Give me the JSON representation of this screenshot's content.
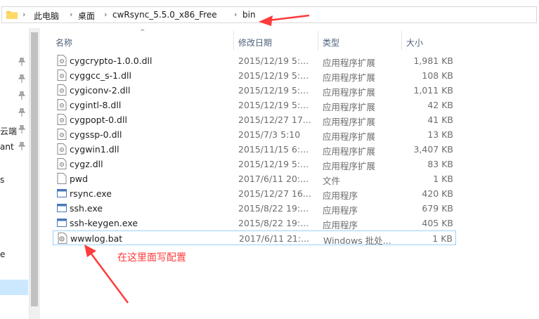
{
  "breadcrumb": [
    "此电脑",
    "桌面",
    "cwRsync_5.5.0_x86_Free",
    "bin"
  ],
  "nav_items": [
    "云端",
    "ant",
    "s",
    "e"
  ],
  "columns": {
    "name": "名称",
    "date": "修改日期",
    "type": "类型",
    "size": "大小"
  },
  "files": [
    {
      "name": "cygcrypto-1.0.0.dll",
      "date": "2015/12/19 5:...",
      "type": "应用程序扩展",
      "size": "1,981 KB",
      "icon": "dll-icon"
    },
    {
      "name": "cyggcc_s-1.dll",
      "date": "2015/12/19 5:...",
      "type": "应用程序扩展",
      "size": "108 KB",
      "icon": "dll-icon"
    },
    {
      "name": "cygiconv-2.dll",
      "date": "2015/12/19 5:...",
      "type": "应用程序扩展",
      "size": "1,011 KB",
      "icon": "dll-icon"
    },
    {
      "name": "cygintl-8.dll",
      "date": "2015/12/19 5:...",
      "type": "应用程序扩展",
      "size": "42 KB",
      "icon": "dll-icon"
    },
    {
      "name": "cygpopt-0.dll",
      "date": "2015/12/27 17...",
      "type": "应用程序扩展",
      "size": "41 KB",
      "icon": "dll-icon"
    },
    {
      "name": "cygssp-0.dll",
      "date": "2015/7/3 5:10",
      "type": "应用程序扩展",
      "size": "13 KB",
      "icon": "dll-icon"
    },
    {
      "name": "cygwin1.dll",
      "date": "2015/11/15 6:...",
      "type": "应用程序扩展",
      "size": "3,407 KB",
      "icon": "dll-icon"
    },
    {
      "name": "cygz.dll",
      "date": "2015/12/19 5:...",
      "type": "应用程序扩展",
      "size": "83 KB",
      "icon": "dll-icon"
    },
    {
      "name": "pwd",
      "date": "2017/6/11 20:...",
      "type": "文件",
      "size": "1 KB",
      "icon": "file-icon"
    },
    {
      "name": "rsync.exe",
      "date": "2015/12/27 16...",
      "type": "应用程序",
      "size": "420 KB",
      "icon": "exe-icon"
    },
    {
      "name": "ssh.exe",
      "date": "2015/8/22 19:...",
      "type": "应用程序",
      "size": "679 KB",
      "icon": "exe-icon"
    },
    {
      "name": "ssh-keygen.exe",
      "date": "2015/8/22 19:...",
      "type": "应用程序",
      "size": "405 KB",
      "icon": "exe-icon"
    },
    {
      "name": "wwwlog.bat",
      "date": "2017/6/11 21:...",
      "type": "Windows 批处...",
      "size": "1 KB",
      "icon": "bat-icon"
    }
  ],
  "annotation": "在这里面写配置",
  "colors": {
    "accent": "#ff3b3b",
    "selection_border": "#99d1ff",
    "nav_selection": "#cce8ff"
  }
}
